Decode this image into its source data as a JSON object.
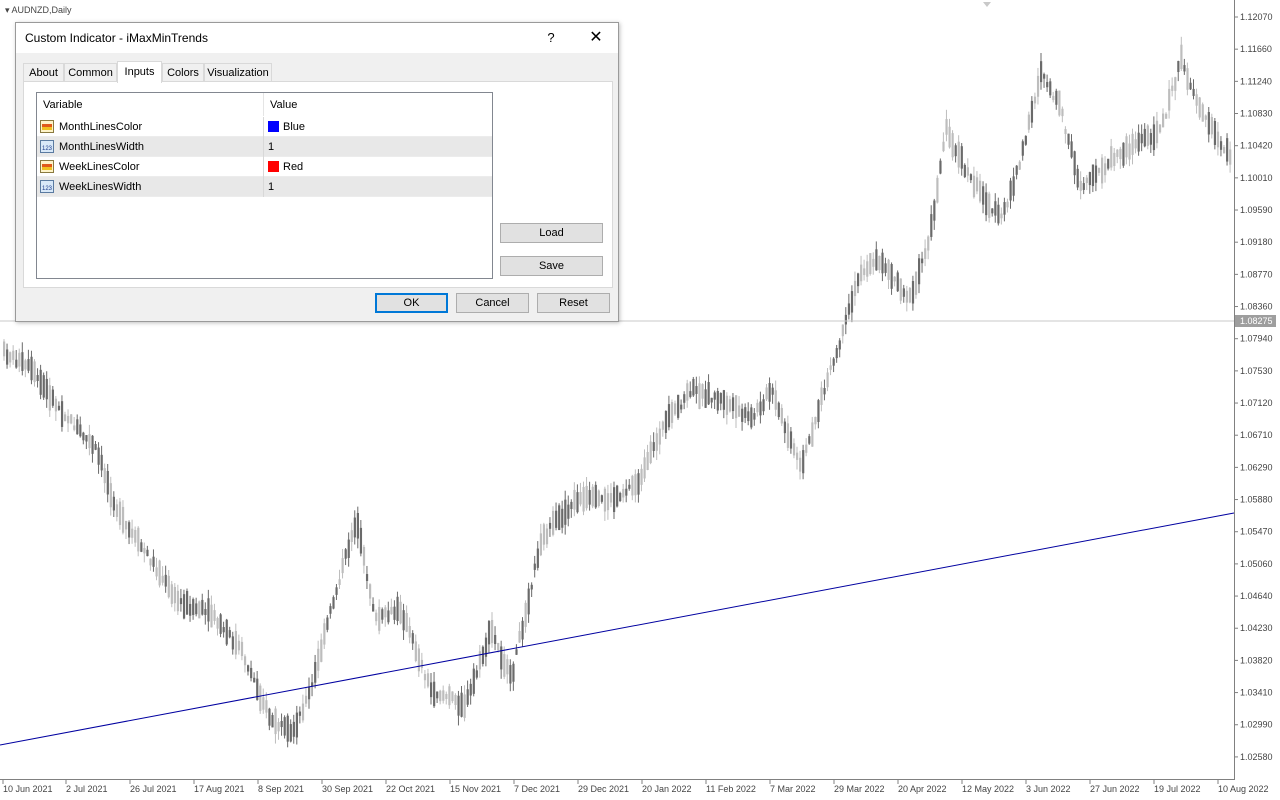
{
  "chart": {
    "symbol_label": "AUDNZD,Daily",
    "price_labels": [
      "1.12070",
      "1.11660",
      "1.11240",
      "1.10830",
      "1.10420",
      "1.10010",
      "1.09590",
      "1.09180",
      "1.08770",
      "1.08360",
      "1.07940",
      "1.07530",
      "1.07120",
      "1.06710",
      "1.06290",
      "1.05880",
      "1.05470",
      "1.05060",
      "1.04640",
      "1.04230",
      "1.03820",
      "1.03410",
      "1.02990",
      "1.02580"
    ],
    "current_price": "1.08275",
    "date_labels": [
      "10 Jun 2021",
      "2 Jul 2021",
      "26 Jul 2021",
      "17 Aug 2021",
      "8 Sep 2021",
      "30 Sep 2021",
      "22 Oct 2021",
      "15 Nov 2021",
      "7 Dec 2021",
      "29 Dec 2021",
      "20 Jan 2022",
      "11 Feb 2022",
      "7 Mar 2022",
      "29 Mar 2022",
      "20 Apr 2022",
      "12 May 2022",
      "3 Jun 2022",
      "27 Jun 2022",
      "19 Jul 2022",
      "10 Aug 2022"
    ],
    "colors": {
      "candle_up": "#bdbdbd",
      "candle_down": "#6a6a6a",
      "trend_line": "#0000a0",
      "current_price_bg": "#9e9e9e"
    }
  },
  "dialog": {
    "title": "Custom Indicator - iMaxMinTrends",
    "help_glyph": "?",
    "close_glyph": "✕",
    "tabs": [
      "About",
      "Common",
      "Inputs",
      "Colors",
      "Visualization"
    ],
    "active_tab": "Inputs",
    "columns": {
      "variable": "Variable",
      "value": "Value"
    },
    "rows": [
      {
        "variable": "MonthLinesColor",
        "value": "Blue",
        "icon": "color-icon",
        "swatch": "#0000ff"
      },
      {
        "variable": "MonthLinesWidth",
        "value": "1",
        "icon": "number-icon"
      },
      {
        "variable": "WeekLinesColor",
        "value": "Red",
        "icon": "color-icon",
        "swatch": "#ff0000"
      },
      {
        "variable": "WeekLinesWidth",
        "value": "1",
        "icon": "number-icon"
      }
    ],
    "buttons": {
      "load": "Load",
      "save": "Save",
      "ok": "OK",
      "cancel": "Cancel",
      "reset": "Reset"
    }
  }
}
